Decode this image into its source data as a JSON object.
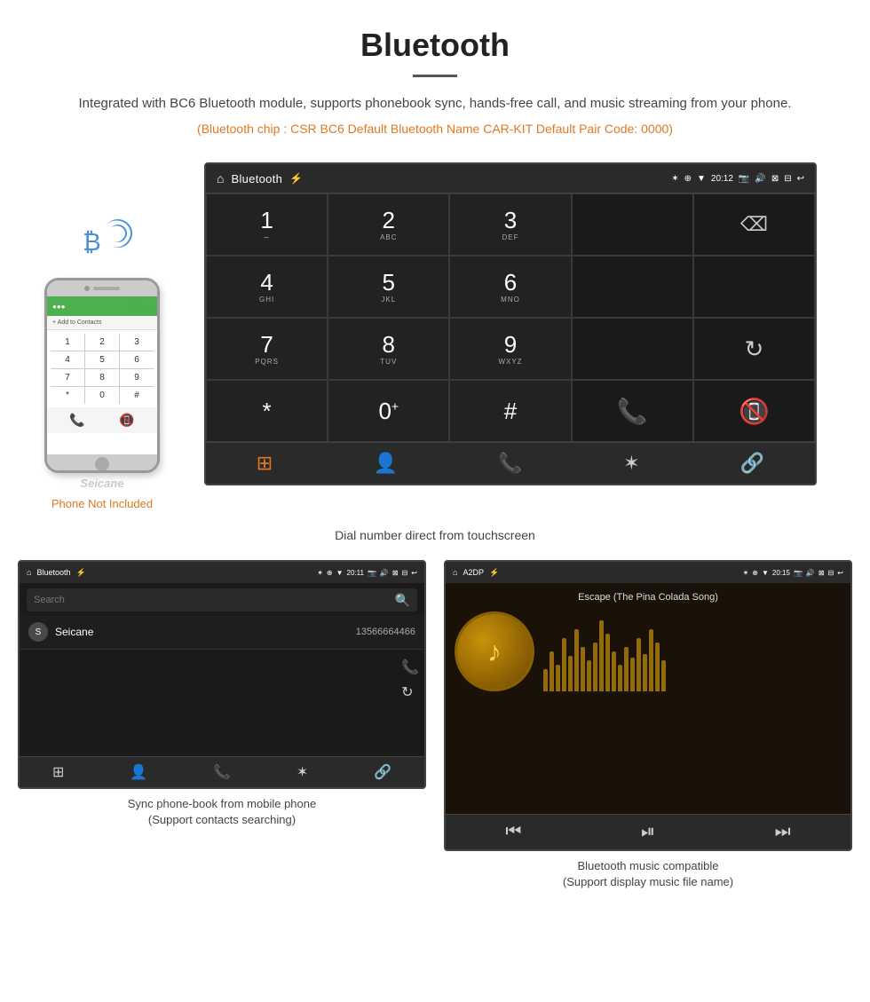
{
  "header": {
    "title": "Bluetooth",
    "description": "Integrated with BC6 Bluetooth module, supports phonebook sync, hands-free call, and music streaming from your phone.",
    "specs": "(Bluetooth chip : CSR BC6    Default Bluetooth Name CAR-KIT    Default Pair Code: 0000)"
  },
  "phone_section": {
    "not_included_label": "Phone Not Included"
  },
  "android_screen": {
    "statusbar": {
      "home_icon": "⌂",
      "title": "Bluetooth",
      "usb_icon": "⚡",
      "time": "20:12",
      "icons": "✶ ⊕ ▼ 📷 🔊 ⊠ ⊟ ↩"
    },
    "dialpad": {
      "keys": [
        {
          "num": "1",
          "letters": "∽"
        },
        {
          "num": "2",
          "letters": "ABC"
        },
        {
          "num": "3",
          "letters": "DEF"
        },
        {
          "num": "",
          "letters": "",
          "type": "empty"
        },
        {
          "num": "⌫",
          "letters": "",
          "type": "backspace"
        },
        {
          "num": "4",
          "letters": "GHI"
        },
        {
          "num": "5",
          "letters": "JKL"
        },
        {
          "num": "6",
          "letters": "MNO"
        },
        {
          "num": "",
          "letters": "",
          "type": "empty"
        },
        {
          "num": "",
          "letters": "",
          "type": "empty"
        },
        {
          "num": "7",
          "letters": "PQRS"
        },
        {
          "num": "8",
          "letters": "TUV"
        },
        {
          "num": "9",
          "letters": "WXYZ"
        },
        {
          "num": "",
          "letters": "",
          "type": "empty"
        },
        {
          "num": "↻",
          "letters": "",
          "type": "refresh"
        },
        {
          "num": "*",
          "letters": ""
        },
        {
          "num": "0",
          "letters": "+"
        },
        {
          "num": "#",
          "letters": ""
        },
        {
          "num": "📞",
          "letters": "",
          "type": "call-green"
        },
        {
          "num": "📵",
          "letters": "",
          "type": "call-red"
        }
      ]
    },
    "bottom_nav": [
      "⊞",
      "👤",
      "📞",
      "✶",
      "🔗"
    ]
  },
  "dial_caption": "Dial number direct from touchscreen",
  "phonebook_screen": {
    "statusbar": {
      "title": "Bluetooth",
      "time": "20:11"
    },
    "search_placeholder": "Search",
    "contacts": [
      {
        "initial": "S",
        "name": "Seicane",
        "number": "13566664466"
      }
    ],
    "bottom_nav": [
      "⊞",
      "👤",
      "📞",
      "✶",
      "🔗"
    ]
  },
  "phonebook_caption": "Sync phone-book from mobile phone\n(Support contacts searching)",
  "music_screen": {
    "statusbar": {
      "title": "A2DP",
      "time": "20:15"
    },
    "song_title": "Escape (The Pina Colada Song)",
    "controls": [
      "⏮",
      "⏯",
      "⏭"
    ]
  },
  "music_caption": "Bluetooth music compatible\n(Support display music file name)"
}
